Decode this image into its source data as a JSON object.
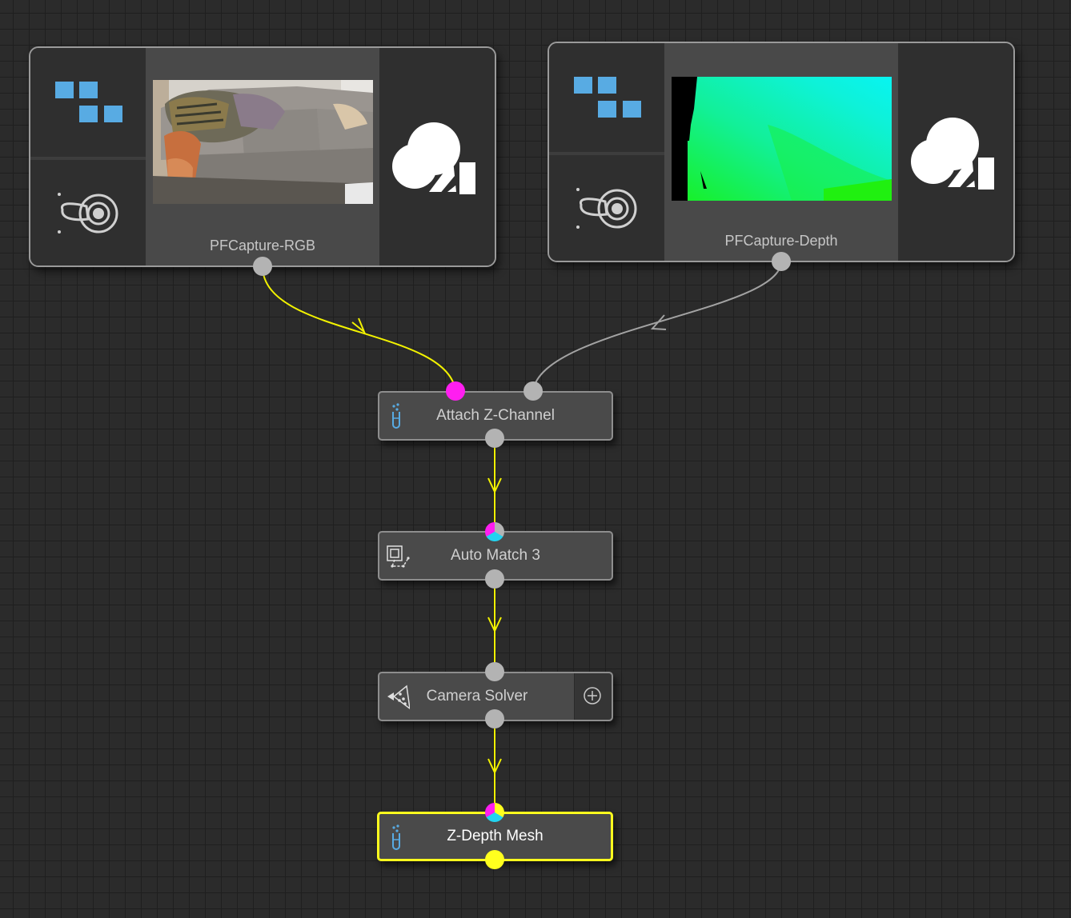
{
  "canvas": {
    "background": "#2b2b2b",
    "grid_line_color": "#1f1f1f",
    "wire_active_color": "#f2f200",
    "wire_inactive_color": "#a3a3a3",
    "port_colors": {
      "default": "#b3b3b3",
      "selected": "#ffff1e",
      "magenta": "#ff1ef0",
      "cyan": "#22d3f0"
    }
  },
  "source_nodes": [
    {
      "title": "PFCapture-RGB",
      "icons": [
        "clip-squares-icon",
        "orbit-target-icon",
        "movie-camera-icon"
      ],
      "accent": "#58abe3"
    },
    {
      "title": "PFCapture-Depth",
      "icons": [
        "clip-squares-icon",
        "orbit-target-icon",
        "movie-camera-icon"
      ],
      "accent": "#58abe3"
    }
  ],
  "process_nodes": [
    {
      "title": "Attach Z-Channel",
      "icon": "test-tube-icon",
      "selected": false
    },
    {
      "title": "Auto Match 3",
      "icon": "auto-match-icon",
      "selected": false
    },
    {
      "title": "Camera Solver",
      "icon": "camera-solver-icon",
      "selected": false,
      "extra_button": "add-input-icon"
    },
    {
      "title": "Z-Depth Mesh",
      "icon": "test-tube-icon",
      "selected": true
    }
  ],
  "connections": [
    {
      "from": "PFCapture-RGB",
      "to": "Attach Z-Channel",
      "active": true
    },
    {
      "from": "PFCapture-Depth",
      "to": "Attach Z-Channel",
      "active": false
    },
    {
      "from": "Attach Z-Channel",
      "to": "Auto Match 3",
      "active": true
    },
    {
      "from": "Auto Match 3",
      "to": "Camera Solver",
      "active": true
    },
    {
      "from": "Camera Solver",
      "to": "Z-Depth Mesh",
      "active": true
    }
  ]
}
